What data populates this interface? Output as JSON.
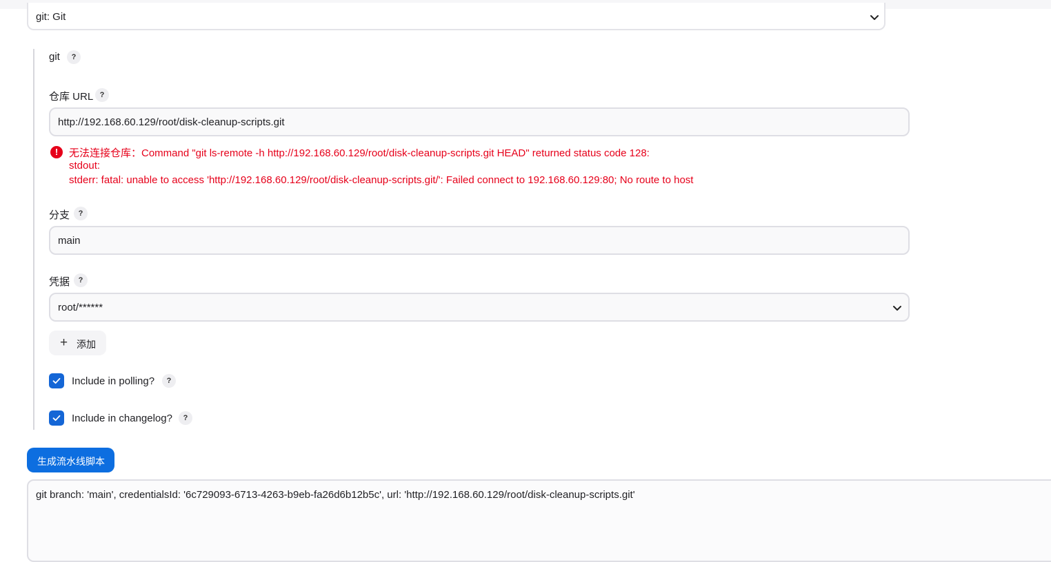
{
  "scm_select": {
    "value": "git: Git"
  },
  "git_section": {
    "label": "git",
    "help": "?"
  },
  "repo": {
    "label": "仓库 URL",
    "help": "?",
    "value": "http://192.168.60.129/root/disk-cleanup-scripts.git",
    "error_lines": [
      "无法连接仓库：Command \"git ls-remote -h http://192.168.60.129/root/disk-cleanup-scripts.git HEAD\" returned status code 128:",
      "stdout:",
      "stderr: fatal: unable to access 'http://192.168.60.129/root/disk-cleanup-scripts.git/': Failed connect to 192.168.60.129:80; No route to host"
    ],
    "error_icon": "!"
  },
  "branch": {
    "label": "分支",
    "help": "?",
    "value": "main"
  },
  "credentials": {
    "label": "凭据",
    "help": "?",
    "value": "root/******"
  },
  "add_button": {
    "icon": "+",
    "label": "添加"
  },
  "polling": {
    "label": "Include in polling?",
    "help": "?",
    "checked": true
  },
  "changelog": {
    "label": "Include in changelog?",
    "help": "?",
    "checked": true
  },
  "generate_button": {
    "label": "生成流水线脚本"
  },
  "output": {
    "value": "git branch: 'main', credentialsId: '6c729093-6713-4263-b9eb-fa26d6b12b5c', url: 'http://192.168.60.129/root/disk-cleanup-scripts.git'"
  },
  "colors": {
    "accent": "#0d6ee0",
    "error": "#e6001a",
    "checkbox": "#1466d6"
  }
}
